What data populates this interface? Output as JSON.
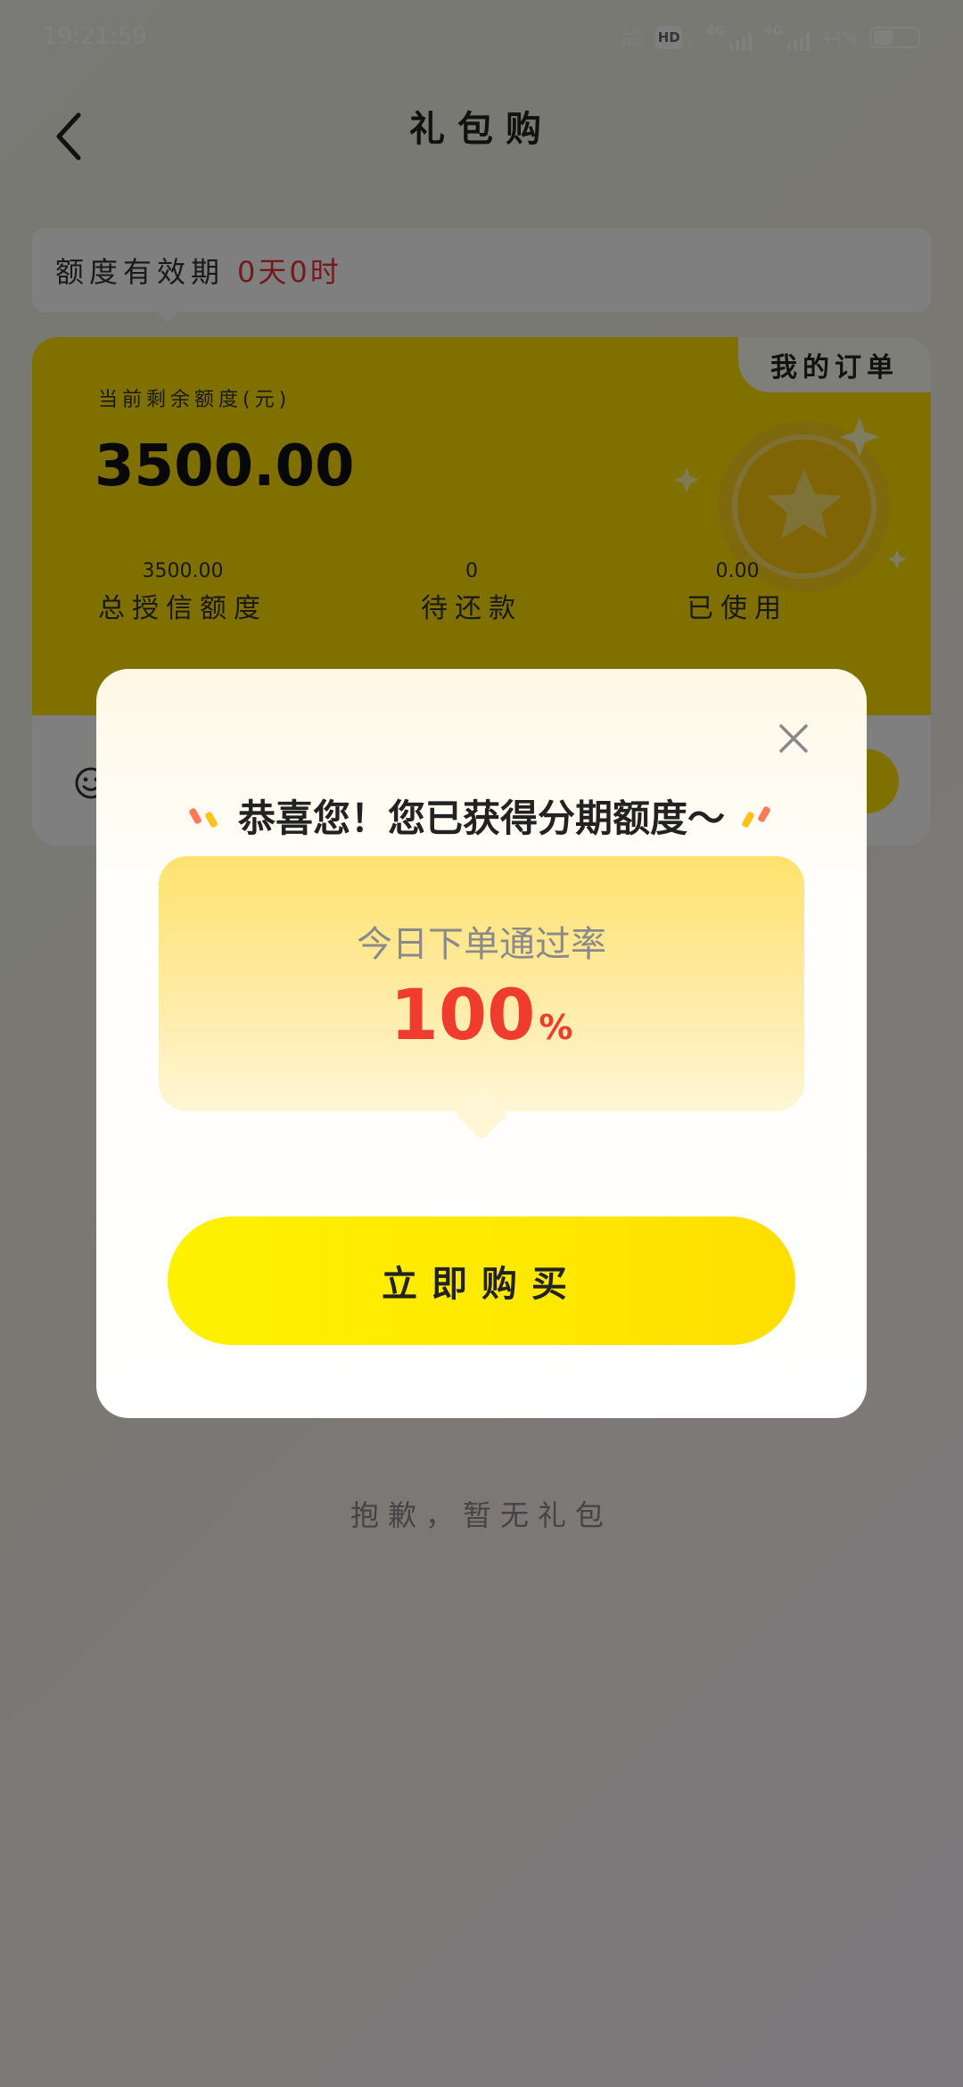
{
  "status_bar": {
    "time": "19:21:59",
    "net_speed_value": "2.30",
    "net_speed_unit": "KB/s",
    "hd_label": "HD",
    "hd_sub": "1",
    "signal_1_label": "4G",
    "signal_2_label": "4G",
    "battery_percent": "44%",
    "battery_level": 0.44
  },
  "header": {
    "title": "礼包购"
  },
  "validity": {
    "label": "额度有效期",
    "value": "0天0时"
  },
  "credit_card": {
    "my_orders_label": "我的订单",
    "remaining_label": "当前剩余额度(元)",
    "remaining_amount": "3500.00",
    "stats": [
      {
        "value": "3500.00",
        "label": "总授信额度"
      },
      {
        "value": "0",
        "label": "待还款"
      },
      {
        "value": "0.00",
        "label": "已使用"
      }
    ]
  },
  "empty_state": {
    "text": "抱歉，暂无礼包"
  },
  "modal": {
    "title": "恭喜您！您已获得分期额度～",
    "rate_label": "今日下单通过率",
    "rate_value": "100",
    "rate_unit": "%",
    "buy_button_label": "立即购买"
  },
  "colors": {
    "accent_yellow": "#ffe100",
    "highlight_red": "#e8353a"
  },
  "icons": {
    "back": "chevron-left-icon",
    "close": "close-icon",
    "coin": "star-coin-icon",
    "smile": "smile-icon"
  }
}
